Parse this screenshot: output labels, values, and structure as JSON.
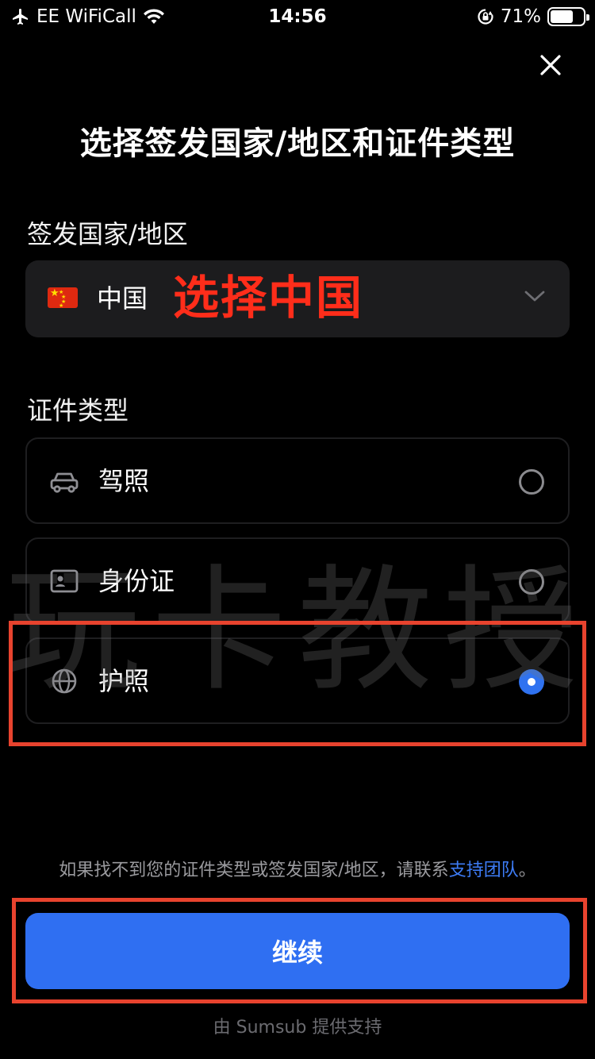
{
  "status_bar": {
    "carrier": "EE WiFiCall",
    "time": "14:56",
    "battery": "71%",
    "battery_level": 0.71
  },
  "page": {
    "title": "选择签发国家/地区和证件类型"
  },
  "country_section": {
    "label": "签发国家/地区",
    "selected_country": "中国",
    "annotation": "选择中国"
  },
  "document_section": {
    "label": "证件类型",
    "options": [
      {
        "label": "驾照",
        "icon": "car-icon",
        "selected": false
      },
      {
        "label": "身份证",
        "icon": "id-card-icon",
        "selected": false
      },
      {
        "label": "护照",
        "icon": "globe-icon",
        "selected": true
      }
    ]
  },
  "watermark": "玩卡教授",
  "help": {
    "text": "如果找不到您的证件类型或签发国家/地区，请联系",
    "link": "支持团队",
    "suffix": "。"
  },
  "continue_button": "继续",
  "footer": "由 Sumsub 提供支持",
  "colors": {
    "background": "#000000",
    "accent": "#2f6ff2",
    "annotation_red": "#ff2d1a",
    "highlight_border": "#e8432e"
  }
}
